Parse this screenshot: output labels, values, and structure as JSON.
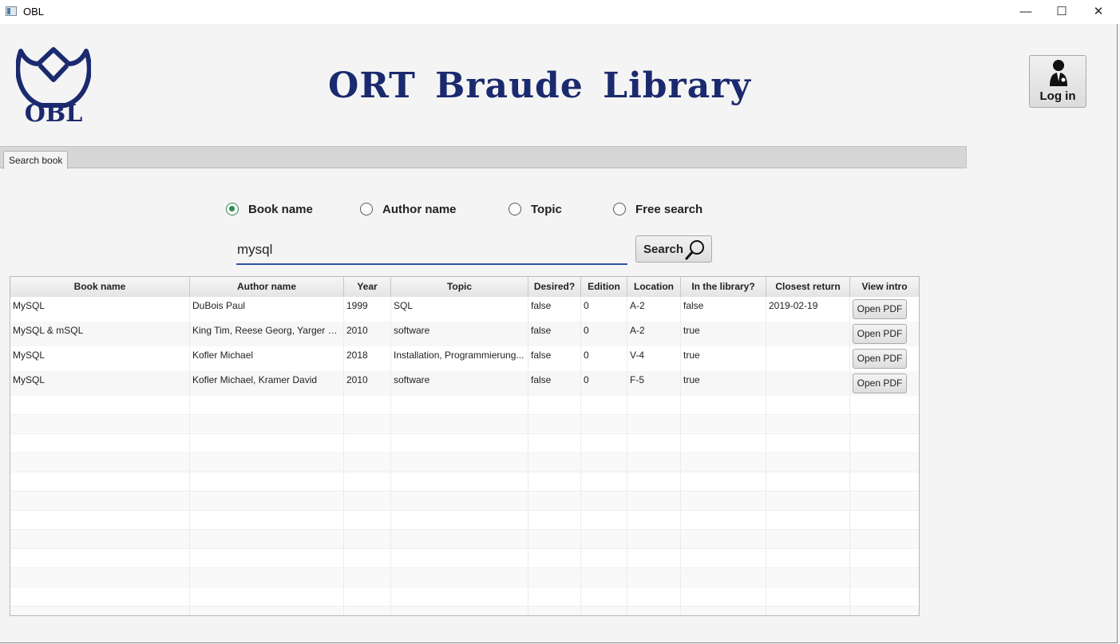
{
  "window": {
    "title": "OBL",
    "minimize": "—",
    "maximize": "☐",
    "close": "✕"
  },
  "header": {
    "logo_text": "OBL",
    "title": "ORT Braude Library",
    "login_label": "Log in",
    "login_icon": "librarian-icon"
  },
  "tabs": [
    {
      "label": "Search book"
    }
  ],
  "search": {
    "options": [
      {
        "label": "Book name",
        "selected": true
      },
      {
        "label": "Author name",
        "selected": false
      },
      {
        "label": "Topic",
        "selected": false
      },
      {
        "label": "Free search",
        "selected": false
      }
    ],
    "query": "mysql",
    "button_label": "Search",
    "button_icon": "magnifier-icon"
  },
  "table": {
    "columns": [
      "Book name",
      "Author name",
      "Year",
      "Topic",
      "Desired?",
      "Edition",
      "Location",
      "In the library?",
      "Closest return",
      "View intro"
    ],
    "rows": [
      {
        "book_name": "MySQL",
        "author_name": "DuBois Paul",
        "year": "1999",
        "topic": "SQL",
        "desired": "false",
        "edition": "0",
        "location": "A-2",
        "in_library": "false",
        "closest_return": "2019-02-19",
        "action": "Open PDF"
      },
      {
        "book_name": "MySQL & mSQL",
        "author_name": "King Tim, Reese Georg, Yarger Ra...",
        "year": "2010",
        "topic": "software",
        "desired": "false",
        "edition": "0",
        "location": "A-2",
        "in_library": "true",
        "closest_return": "",
        "action": "Open PDF"
      },
      {
        "book_name": "MySQL",
        "author_name": "Kofler Michael",
        "year": "2018",
        "topic": "Installation, Programmierung...",
        "desired": "false",
        "edition": "0",
        "location": "V-4",
        "in_library": "true",
        "closest_return": "",
        "action": "Open PDF"
      },
      {
        "book_name": "MySQL",
        "author_name": "Kofler Michael, Kramer David",
        "year": "2010",
        "topic": "software",
        "desired": "false",
        "edition": "0",
        "location": "F-5",
        "in_library": "true",
        "closest_return": "",
        "action": "Open PDF"
      }
    ]
  },
  "colors": {
    "brand": "#1b2a6e",
    "radio_selected": "#2f8a4e",
    "input_underline": "#2f55a4"
  }
}
